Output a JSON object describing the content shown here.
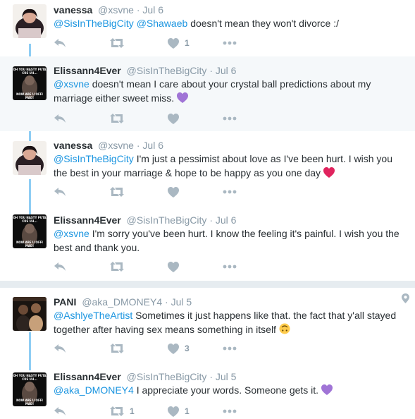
{
  "tweets": [
    {
      "name": "vanessa",
      "handle": "@xsvne",
      "dot": "·",
      "time": "Jul 6",
      "m1": "@SisInTheBigCity",
      "m2": "@Shawaeb",
      "text": "doesn't mean they won't divorce :/",
      "likes": "1"
    },
    {
      "name": "Elissann4Ever",
      "handle": "@SisInTheBigCity",
      "dot": "·",
      "time": "Jul 6",
      "m1": "@xsvne",
      "text": "doesn't mean I care about your crystal ball predictions about my marriage either sweet miss."
    },
    {
      "name": "vanessa",
      "handle": "@xsvne",
      "dot": "·",
      "time": "Jul 6",
      "m1": "@SisInTheBigCity",
      "text": "I'm just a pessimist about love as I've been hurt. I wish you the best in your marriage & hope to be happy as you one day"
    },
    {
      "name": "Elissann4Ever",
      "handle": "@SisInTheBigCity",
      "dot": "·",
      "time": "Jul 6",
      "m1": "@xsvne",
      "text": "I'm sorry you've been hurt. I know the feeling it's painful. I wish you the best and thank you."
    },
    {
      "name": "PANI",
      "handle": "@aka_DMONEY4",
      "dot": "·",
      "time": "Jul 5",
      "m1": "@AshlyeTheArtist",
      "text": "Sometimes it just happens like that. the fact that y'all stayed together after having sex means something in itself",
      "likes": "3"
    },
    {
      "name": "Elissann4Ever",
      "handle": "@SisInTheBigCity",
      "dot": "·",
      "time": "Jul 5",
      "m1": "@aka_DMONEY4",
      "text": "I appreciate your words. Someone gets it.",
      "retweets": "1",
      "likes": "1"
    }
  ],
  "avatar_text": {
    "top": "OH YOU NASTY PUTA CUS UH...",
    "bottom": "NOW ARE U OFFI MAD!"
  },
  "icons": [
    "reply-icon",
    "retweet-icon",
    "like-icon",
    "more-icon",
    "location-pin-icon",
    "purple-heart-emoji",
    "red-heart-emoji",
    "upside-down-face-emoji"
  ],
  "colors": {
    "link": "#1b95e0",
    "muted": "#8899a6",
    "action": "#aab8c2",
    "thread": "#8ecdf4",
    "highlight": "#f5f8fa"
  }
}
